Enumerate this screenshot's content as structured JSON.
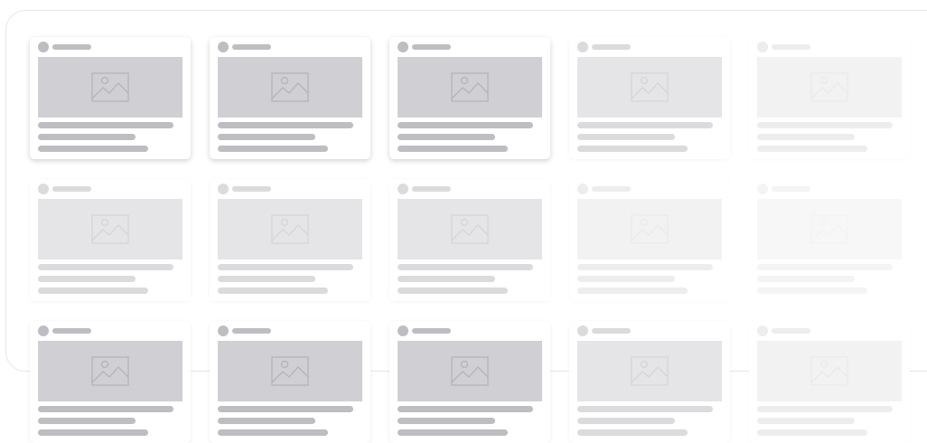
{
  "icons": {
    "card_thumbnail": "image-placeholder-icon",
    "card_avatar": "avatar-dot-placeholder"
  },
  "colors": {
    "frame_border": "#e6e6e6",
    "placeholder_strong": "#d0d0d4",
    "placeholder_text_strong": "#bdbdc2",
    "placeholder_mid": "#e3e3e5",
    "placeholder_faint": "#f1f1f2",
    "placeholder_very_faint": "#f6f6f6"
  },
  "grid": {
    "rows": 3,
    "columns": 5,
    "state": "loading-skeleton"
  }
}
